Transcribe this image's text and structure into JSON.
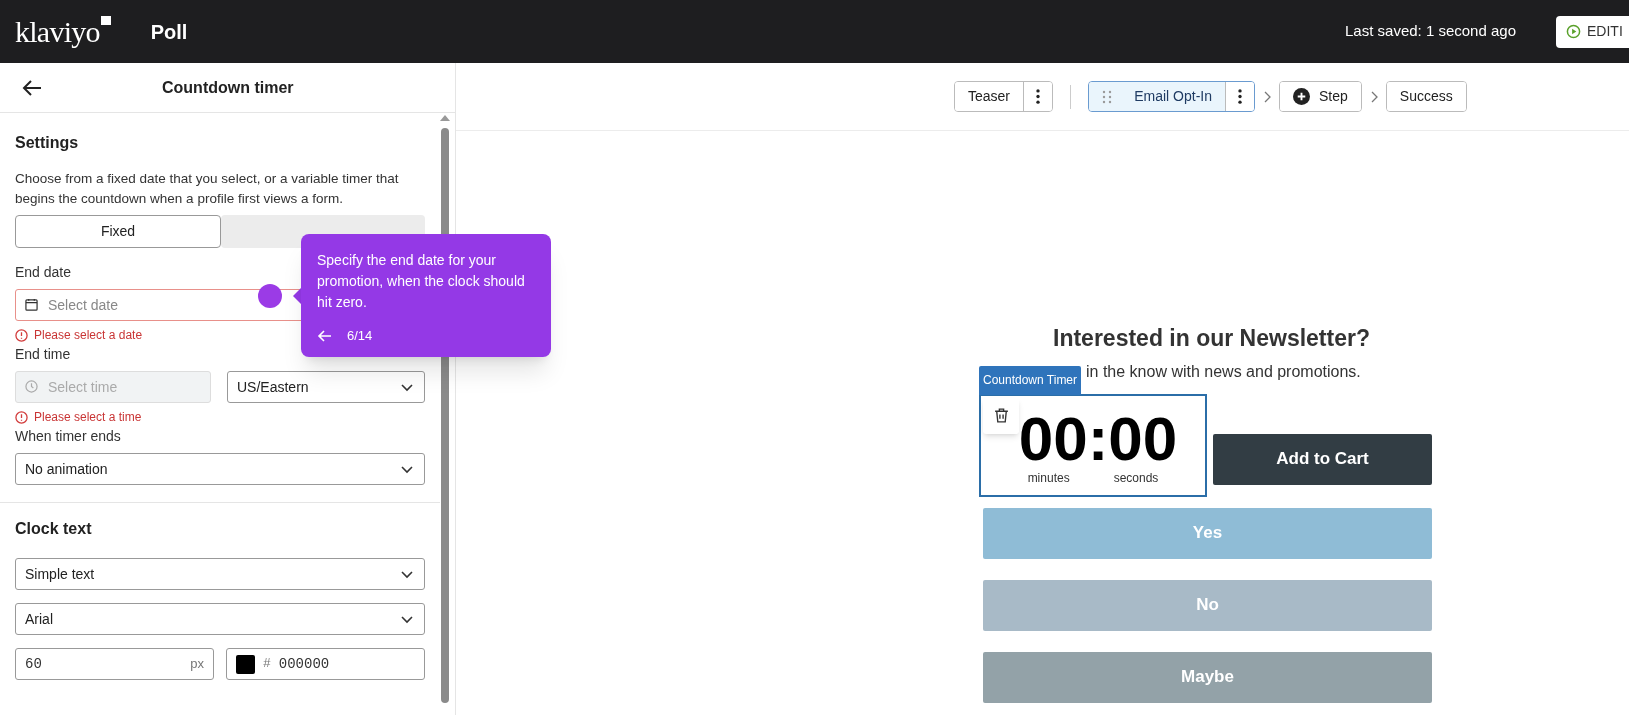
{
  "topbar": {
    "logo": "klaviyo",
    "title": "Poll",
    "last_saved": "Last saved: 1 second ago",
    "edit_button": "EDITI"
  },
  "panel": {
    "title": "Countdown timer",
    "settings": {
      "heading": "Settings",
      "description": "Choose from a fixed date that you select, or a variable timer that begins the countdown when a profile first views a form.",
      "mode_tabs": [
        {
          "label": "Fixed",
          "selected": true
        },
        {
          "selected": false
        }
      ],
      "end_date": {
        "label": "End date",
        "placeholder": "Select date",
        "error": "Please select a date"
      },
      "end_time": {
        "label": "End time",
        "placeholder": "Select time",
        "disabled": true,
        "error": "Please select a time",
        "timezone": "US/Eastern"
      },
      "when_timer_ends": {
        "label": "When timer ends",
        "value": "No animation"
      }
    },
    "clock_text": {
      "heading": "Clock text",
      "style": "Simple text",
      "font": "Arial",
      "size": "60",
      "unit": "px",
      "color_prefix": "#",
      "color_value": "000000"
    }
  },
  "step_groups": [
    [
      {
        "label": "Teaser",
        "kind": "step",
        "menu": true,
        "selected": false
      }
    ],
    [
      {
        "label": "Email Opt-In",
        "kind": "step",
        "menu": true,
        "selected": true
      },
      {
        "label": "Step",
        "kind": "add",
        "menu": false,
        "selected": false
      },
      {
        "label": "Success",
        "kind": "step",
        "menu": false,
        "selected": false
      }
    ]
  ],
  "preview": {
    "heading": "Interested in our Newsletter?",
    "subtitle": "in the know with news and promotions.",
    "timer": {
      "tag": "Countdown Timer",
      "time": "00:00",
      "minutes_label": "minutes",
      "seconds_label": "seconds"
    },
    "cart_button": "Add to Cart",
    "options": [
      {
        "label": "Yes",
        "color": "#8fbcd6"
      },
      {
        "label": "No",
        "color": "#a8bac7"
      },
      {
        "label": "Maybe",
        "color": "#93a2a8"
      }
    ]
  },
  "tooltip": {
    "text": "Specify the end date for your promotion, when the clock should hit zero.",
    "progress": "6/14"
  }
}
